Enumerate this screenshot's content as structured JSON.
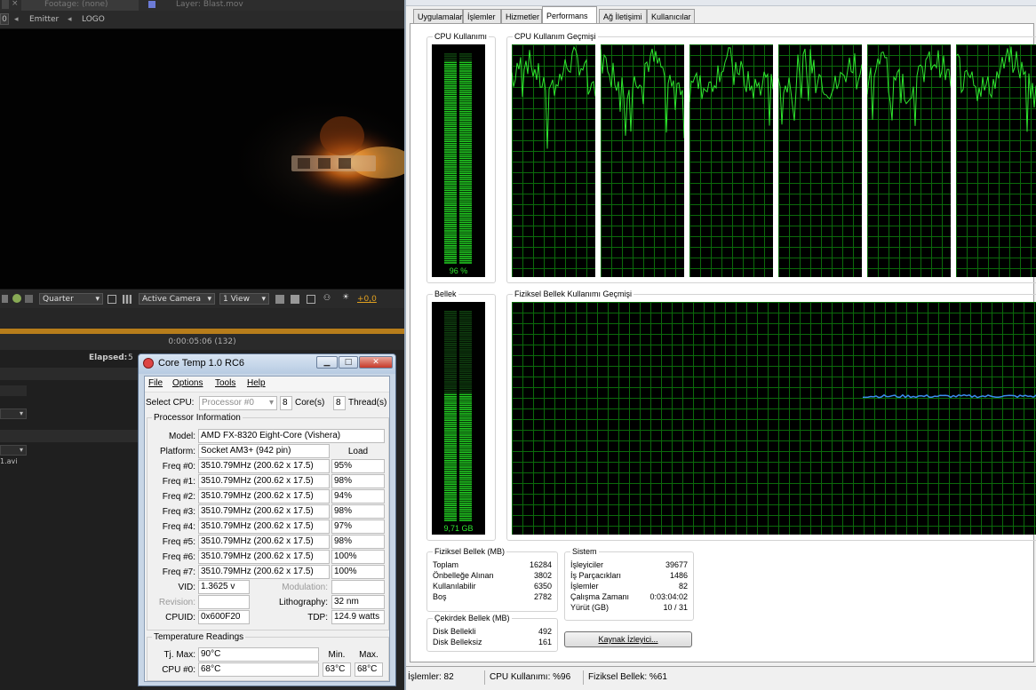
{
  "ae": {
    "tab_footage": "Footage: (none)",
    "tab_layer": "Layer: Blast.mov",
    "crumb_value": "0",
    "crumb_emitter": "Emitter",
    "crumb_logo": "LOGO",
    "resolution": "Quarter",
    "camera": "Active Camera",
    "view": "1 View",
    "exposure": "+0,0",
    "timecode": "0:00:05:06 (132)",
    "elapsed_label": "Elapsed:",
    "elapsed_value": "5",
    "file_fragment": "1.avi"
  },
  "coretemp": {
    "title": "Core Temp 1.0 RC6",
    "menu": [
      "File",
      "Options",
      "Tools",
      "Help"
    ],
    "select_cpu_label": "Select CPU:",
    "select_cpu_value": "Processor #0",
    "cores_count": "8",
    "cores_label": "Core(s)",
    "threads_count": "8",
    "threads_label": "Thread(s)",
    "proc_info_label": "Processor Information",
    "model_label": "Model:",
    "model_value": "AMD FX-8320 Eight-Core (Vishera)",
    "platform_label": "Platform:",
    "platform_value": "Socket AM3+ (942 pin)",
    "load_header": "Load",
    "freqs": [
      {
        "label": "Freq #0:",
        "value": "3510.79MHz (200.62 x 17.5)",
        "load": "95%"
      },
      {
        "label": "Freq #1:",
        "value": "3510.79MHz (200.62 x 17.5)",
        "load": "98%"
      },
      {
        "label": "Freq #2:",
        "value": "3510.79MHz (200.62 x 17.5)",
        "load": "94%"
      },
      {
        "label": "Freq #3:",
        "value": "3510.79MHz (200.62 x 17.5)",
        "load": "98%"
      },
      {
        "label": "Freq #4:",
        "value": "3510.79MHz (200.62 x 17.5)",
        "load": "97%"
      },
      {
        "label": "Freq #5:",
        "value": "3510.79MHz (200.62 x 17.5)",
        "load": "98%"
      },
      {
        "label": "Freq #6:",
        "value": "3510.79MHz (200.62 x 17.5)",
        "load": "100%"
      },
      {
        "label": "Freq #7:",
        "value": "3510.79MHz (200.62 x 17.5)",
        "load": "100%"
      }
    ],
    "vid_label": "VID:",
    "vid_value": "1.3625 v",
    "modulation_label": "Modulation:",
    "revision_label": "Revision:",
    "lithography_label": "Lithography:",
    "lithography_value": "32 nm",
    "cpuid_label": "CPUID:",
    "cpuid_value": "0x600F20",
    "tdp_label": "TDP:",
    "tdp_value": "124.9 watts",
    "temp_header": "Temperature Readings",
    "tjmax_label": "Tj. Max:",
    "tjmax_value": "90°C",
    "min_label": "Min.",
    "max_label": "Max.",
    "cpu0_label": "CPU #0:",
    "cpu0_value": "68°C",
    "cpu0_min": "63°C",
    "cpu0_max": "68°C"
  },
  "taskmgr": {
    "tabs": [
      "Uygulamalar",
      "İşlemler",
      "Hizmetler",
      "Performans",
      "Ağ İletişimi",
      "Kullanıcılar"
    ],
    "active_tab": "Performans",
    "cpu_usage_label": "CPU Kullanımı",
    "cpu_usage_value": "96 %",
    "cpu_usage_fraction": 0.96,
    "cpu_history_label": "CPU Kullanım Geçmişi",
    "memory_label": "Bellek",
    "memory_value": "9,71 GB",
    "memory_fraction": 0.61,
    "memory_history_label": "Fiziksel Bellek Kullanımı Geçmişi",
    "physical": {
      "title": "Fiziksel Bellek (MB)",
      "rows": [
        {
          "k": "Toplam",
          "v": "16284"
        },
        {
          "k": "Önbelleğe Alınan",
          "v": "3802"
        },
        {
          "k": "Kullanılabilir",
          "v": "6350"
        },
        {
          "k": "Boş",
          "v": "2782"
        }
      ]
    },
    "kernel": {
      "title": "Çekirdek Bellek (MB)",
      "rows": [
        {
          "k": "Disk Bellekli",
          "v": "492"
        },
        {
          "k": "Disk Belleksiz",
          "v": "161"
        }
      ]
    },
    "system": {
      "title": "Sistem",
      "rows": [
        {
          "k": "İşleyiciler",
          "v": "39677"
        },
        {
          "k": "İş Parçacıkları",
          "v": "1486"
        },
        {
          "k": "İşlemler",
          "v": "82"
        },
        {
          "k": "Çalışma Zamanı",
          "v": "0:03:04:02"
        },
        {
          "k": "Yürüt (GB)",
          "v": "10 / 31"
        }
      ]
    },
    "resource_button": "Kaynak İzleyici...",
    "status": {
      "processes": "İşlemler: 82",
      "cpu": "CPU Kullanımı: %96",
      "memory": "Fiziksel Bellek: %61"
    },
    "colors": {
      "grid": "#0b6a0b",
      "cpu_line": "#2fe62f",
      "mem_line": "#3c8cf0",
      "meter_on": "#21c821",
      "meter_off": "#0f3f0f"
    }
  }
}
